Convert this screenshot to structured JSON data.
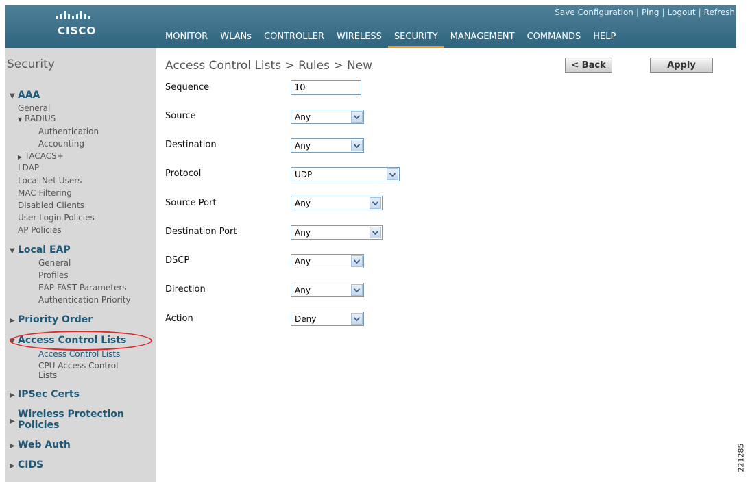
{
  "header": {
    "logo_text": "CISCO",
    "utility_links": [
      "Save Configuration",
      "Ping",
      "Logout",
      "Refresh"
    ],
    "nav": [
      "MONITOR",
      "WLANs",
      "CONTROLLER",
      "WIRELESS",
      "SECURITY",
      "MANAGEMENT",
      "COMMANDS",
      "HELP"
    ],
    "active_nav": "SECURITY",
    "accent_color": "#f39a1e"
  },
  "sidebar": {
    "title": "Security",
    "aaa": {
      "label": "AAA",
      "general": "General",
      "radius": "RADIUS",
      "authentication": "Authentication",
      "accounting": "Accounting",
      "tacacs": "TACACS+",
      "ldap": "LDAP",
      "local_net_users": "Local Net Users",
      "mac_filtering": "MAC Filtering",
      "disabled_clients": "Disabled Clients",
      "user_login_policies": "User Login Policies",
      "ap_policies": "AP Policies"
    },
    "local_eap": {
      "label": "Local EAP",
      "general": "General",
      "profiles": "Profiles",
      "eap_fast": "EAP-FAST Parameters",
      "auth_priority": "Authentication Priority"
    },
    "priority_order": "Priority Order",
    "acl": {
      "label": "Access Control Lists",
      "item1": "Access Control Lists",
      "item2_line1": "CPU Access Control",
      "item2_line2": "Lists"
    },
    "ipsec_certs": "IPSec Certs",
    "wireless_protection_line1": "Wireless Protection",
    "wireless_protection_line2": "Policies",
    "web_auth": "Web Auth",
    "cids": "CIDS"
  },
  "content": {
    "title": "Access Control Lists > Rules > New",
    "back_label": "< Back",
    "apply_label": "Apply",
    "form": {
      "sequence": {
        "label": "Sequence",
        "value": "10"
      },
      "source": {
        "label": "Source",
        "value": "Any"
      },
      "destination": {
        "label": "Destination",
        "value": "Any"
      },
      "protocol": {
        "label": "Protocol",
        "value": "UDP"
      },
      "source_port": {
        "label": "Source Port",
        "value": "Any"
      },
      "destination_port": {
        "label": "Destination Port",
        "value": "Any"
      },
      "dscp": {
        "label": "DSCP",
        "value": "Any"
      },
      "direction": {
        "label": "Direction",
        "value": "Any"
      },
      "action": {
        "label": "Action",
        "value": "Deny"
      }
    }
  },
  "figure_number": "221285"
}
